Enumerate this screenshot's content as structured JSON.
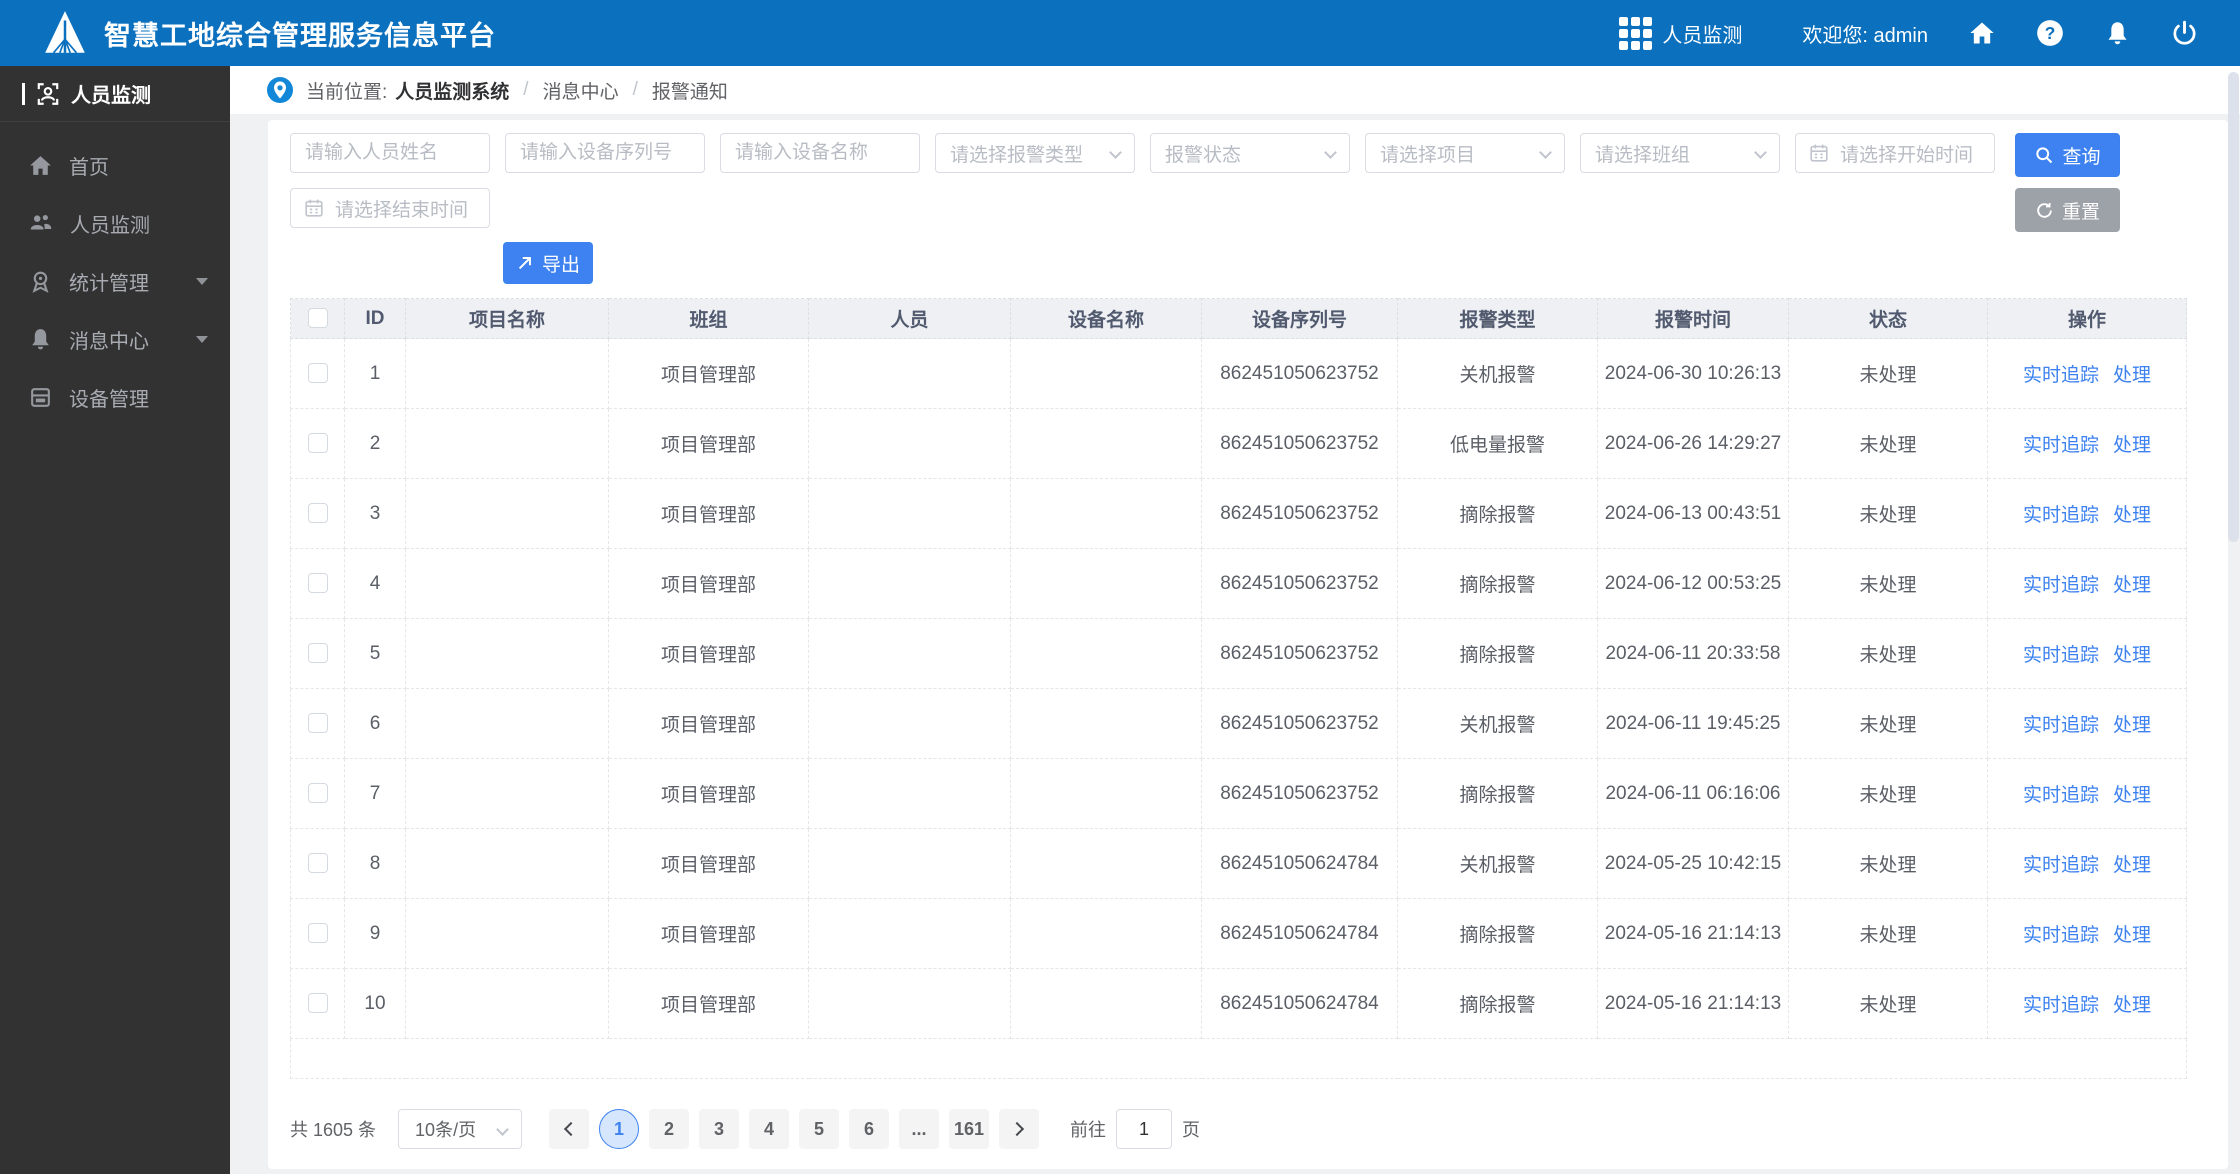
{
  "colors": {
    "header_bg": "#0b70bd",
    "accent_blue": "#3d82f0",
    "sidebar_bg": "#323232",
    "reset_gray": "#9da1a8"
  },
  "header": {
    "title": "智慧工地综合管理服务信息平台",
    "app_switch_label": "人员监测",
    "welcome_label": "欢迎您:",
    "username": "admin",
    "icons": [
      "grid-icon",
      "home-icon",
      "help-icon",
      "bell-icon",
      "power-icon"
    ]
  },
  "sidebar": {
    "title": "人员监测",
    "items": [
      {
        "label": "首页",
        "icon": "home-icon",
        "has_children": false
      },
      {
        "label": "人员监测",
        "icon": "people-icon",
        "has_children": false
      },
      {
        "label": "统计管理",
        "icon": "stats-icon",
        "has_children": true
      },
      {
        "label": "消息中心",
        "icon": "message-icon",
        "has_children": true
      },
      {
        "label": "设备管理",
        "icon": "device-icon",
        "has_children": false
      }
    ]
  },
  "breadcrumb": {
    "prefix": "当前位置:",
    "items": [
      "人员监测系统",
      "消息中心",
      "报警通知"
    ],
    "separator": "/"
  },
  "filters": {
    "name_placeholder": "请输入人员姓名",
    "serial_placeholder": "请输入设备序列号",
    "device_name_placeholder": "请输入设备名称",
    "alarm_type_placeholder": "请选择报警类型",
    "alarm_status_placeholder": "报警状态",
    "project_placeholder": "请选择项目",
    "team_placeholder": "请选择班组",
    "start_time_placeholder": "请选择开始时间",
    "end_time_placeholder": "请选择结束时间",
    "search_label": "查询",
    "reset_label": "重置",
    "export_label": "导出"
  },
  "table": {
    "columns": [
      "ID",
      "项目名称",
      "班组",
      "人员",
      "设备名称",
      "设备序列号",
      "报警类型",
      "报警时间",
      "状态",
      "操作"
    ],
    "action_labels": [
      "实时追踪",
      "处理"
    ],
    "rows": [
      {
        "id": "1",
        "project": "",
        "team": "项目管理部",
        "person": "",
        "device_name": "",
        "serial": "862451050623752",
        "alarm_type": "关机报警",
        "alarm_time": "2024-06-30 10:26:13",
        "status": "未处理"
      },
      {
        "id": "2",
        "project": "",
        "team": "项目管理部",
        "person": "",
        "device_name": "",
        "serial": "862451050623752",
        "alarm_type": "低电量报警",
        "alarm_time": "2024-06-26 14:29:27",
        "status": "未处理"
      },
      {
        "id": "3",
        "project": "",
        "team": "项目管理部",
        "person": "",
        "device_name": "",
        "serial": "862451050623752",
        "alarm_type": "摘除报警",
        "alarm_time": "2024-06-13 00:43:51",
        "status": "未处理"
      },
      {
        "id": "4",
        "project": "",
        "team": "项目管理部",
        "person": "",
        "device_name": "",
        "serial": "862451050623752",
        "alarm_type": "摘除报警",
        "alarm_time": "2024-06-12 00:53:25",
        "status": "未处理"
      },
      {
        "id": "5",
        "project": "",
        "team": "项目管理部",
        "person": "",
        "device_name": "",
        "serial": "862451050623752",
        "alarm_type": "摘除报警",
        "alarm_time": "2024-06-11 20:33:58",
        "status": "未处理"
      },
      {
        "id": "6",
        "project": "",
        "team": "项目管理部",
        "person": "",
        "device_name": "",
        "serial": "862451050623752",
        "alarm_type": "关机报警",
        "alarm_time": "2024-06-11 19:45:25",
        "status": "未处理"
      },
      {
        "id": "7",
        "project": "",
        "team": "项目管理部",
        "person": "",
        "device_name": "",
        "serial": "862451050623752",
        "alarm_type": "摘除报警",
        "alarm_time": "2024-06-11 06:16:06",
        "status": "未处理"
      },
      {
        "id": "8",
        "project": "",
        "team": "项目管理部",
        "person": "",
        "device_name": "",
        "serial": "862451050624784",
        "alarm_type": "关机报警",
        "alarm_time": "2024-05-25 10:42:15",
        "status": "未处理"
      },
      {
        "id": "9",
        "project": "",
        "team": "项目管理部",
        "person": "",
        "device_name": "",
        "serial": "862451050624784",
        "alarm_type": "摘除报警",
        "alarm_time": "2024-05-16 21:14:13",
        "status": "未处理"
      },
      {
        "id": "10",
        "project": "",
        "team": "项目管理部",
        "person": "",
        "device_name": "",
        "serial": "862451050624784",
        "alarm_type": "摘除报警",
        "alarm_time": "2024-05-16 21:14:13",
        "status": "未处理"
      }
    ]
  },
  "pagination": {
    "total_label": "共 1605 条",
    "page_size_label": "10条/页",
    "pages": [
      "1",
      "2",
      "3",
      "4",
      "5",
      "6",
      "...",
      "161"
    ],
    "active_page": "1",
    "goto_prefix": "前往",
    "goto_value": "1",
    "goto_suffix": "页"
  }
}
